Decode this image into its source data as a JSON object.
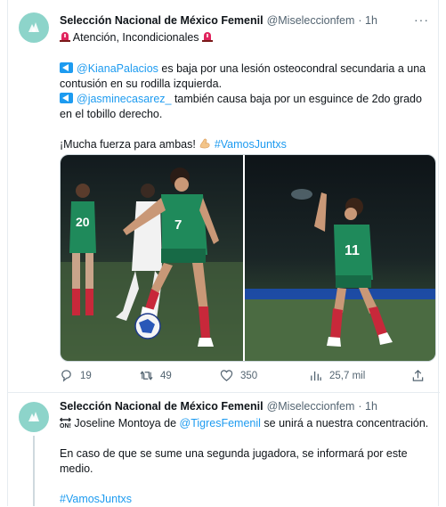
{
  "tweets": [
    {
      "display_name": "Selección Nacional de México Femenil",
      "handle": "@Miseleccionfem",
      "time": "· 1h",
      "more": "···",
      "headline": "Atención, Incondicionales",
      "p1_mention": "@KianaPalacios",
      "p1_text_a": " es baja por una lesión osteocondral secundaria a una",
      "p1_text_b": "contusión en su rodilla izquierda.",
      "p2_mention": "@jasminecasarez_",
      "p2_text_a": " también causa baja por un esguince de 2do grado",
      "p2_text_b": "en el tobillo derecho.",
      "closing_text": "¡Mucha fuerza para ambas! ",
      "closing_hashtag": "#VamosJuntxs",
      "actions": {
        "replies": "19",
        "retweets": "49",
        "likes": "350",
        "views": "25,7 mil"
      }
    },
    {
      "display_name": "Selección Nacional de México Femenil",
      "handle": "@Miseleccionfem",
      "time": "· 1h",
      "badge": "ON!",
      "text_a": " Joseline Montoya de ",
      "mention": "@TigresFemenil",
      "text_b": " se unirá a nuestra concentración.",
      "para_a": "En caso de que se sume una segunda jugadora, se informará por este",
      "para_b": "medio.",
      "hashtag": "#VamosJuntxs"
    }
  ],
  "colors": {
    "accent": "#1d9bf0",
    "avatar_bg": "#8dd4ca",
    "jersey_green": "#1f8a5b",
    "sock_red": "#c8283a",
    "pitch": "#3f5a3a"
  }
}
